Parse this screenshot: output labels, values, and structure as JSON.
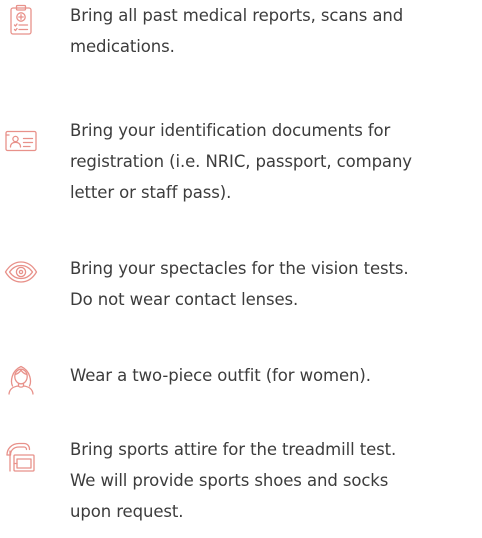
{
  "theme": {
    "accent": "#e8918a",
    "text": "#3c3c3c",
    "background": "#ffffff"
  },
  "items": [
    {
      "icon": "medical-report-clipboard-icon",
      "lines": [
        "Bring all past medical reports, scans and",
        "medications."
      ]
    },
    {
      "icon": "id-card-icon",
      "lines": [
        "Bring your identification documents for",
        "registration (i.e. NRIC, passport, company",
        "letter or staff pass)."
      ]
    },
    {
      "icon": "eye-icon",
      "lines": [
        "Bring your spectacles for the vision tests.",
        "Do not wear contact lenses."
      ]
    },
    {
      "icon": "woman-icon",
      "lines": [
        "Wear a two-piece outfit (for women)."
      ]
    },
    {
      "icon": "treadmill-icon",
      "lines": [
        "Bring sports attire for the treadmill test.",
        "We will provide sports shoes and socks",
        "upon request."
      ]
    }
  ]
}
